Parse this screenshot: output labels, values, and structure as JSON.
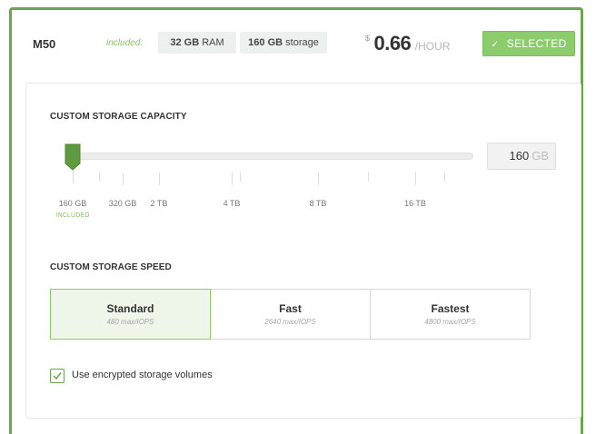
{
  "plan": {
    "name": "M50",
    "included_label": "included:",
    "ram_value": "32 GB",
    "ram_unit": "RAM",
    "storage_value": "160 GB",
    "storage_unit": "storage",
    "currency": "$",
    "price": "0.66",
    "price_unit": "/HOUR",
    "selected_label": "SELECTED",
    "accent_color": "#6ba54a"
  },
  "storage_capacity": {
    "title": "CUSTOM STORAGE CAPACITY",
    "value": "160",
    "unit": "GB",
    "slider_level": 0.0,
    "ticks": [
      {
        "label": "160 GB",
        "sub": "INCLUDED"
      },
      {
        "label": "320 GB"
      },
      {
        "label": "2 TB"
      },
      {
        "label": "4 TB"
      },
      {
        "label": "8 TB"
      },
      {
        "label": "16 TB"
      }
    ]
  },
  "storage_speed": {
    "title": "CUSTOM STORAGE SPEED",
    "options": [
      {
        "name": "Standard",
        "iops": "480 max/IOPS",
        "selected": true
      },
      {
        "name": "Fast",
        "iops": "2640 max/IOPS",
        "selected": false
      },
      {
        "name": "Fastest",
        "iops": "4800 max/IOPS",
        "selected": false
      }
    ]
  },
  "encryption": {
    "label": "Use encrypted storage volumes",
    "checked": true
  }
}
